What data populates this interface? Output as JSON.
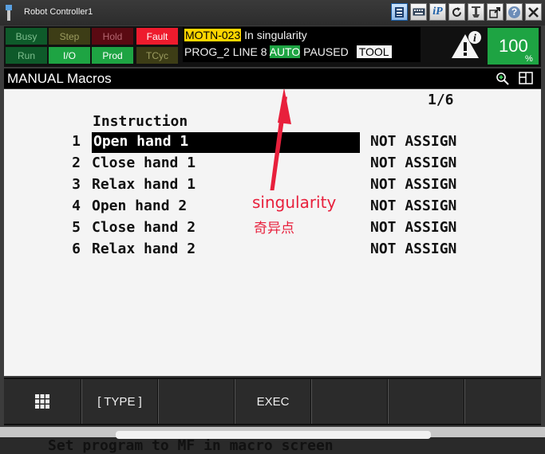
{
  "window": {
    "title": "Robot Controller1"
  },
  "toolbar": {
    "icons": [
      {
        "name": "status-icon",
        "selected": true
      },
      {
        "name": "keyboard-icon",
        "selected": false
      },
      {
        "name": "ip-icon",
        "label": "iP",
        "selected": false
      },
      {
        "name": "refresh-icon",
        "selected": false
      },
      {
        "name": "jog-icon",
        "selected": false
      },
      {
        "name": "external-icon",
        "selected": false
      },
      {
        "name": "help-icon",
        "label": "?",
        "selected": false
      },
      {
        "name": "close-icon",
        "selected": false
      }
    ]
  },
  "status_leds": [
    {
      "label": "Busy",
      "color": "#0e5a2a",
      "text_color": "#7fbf8f"
    },
    {
      "label": "Step",
      "color": "#3d3d16",
      "text_color": "#9c9c60"
    },
    {
      "label": "Hold",
      "color": "#5a0a12",
      "text_color": "#b46670"
    },
    {
      "label": "Fault",
      "color": "#ee1b2d",
      "text_color": "#ffffff"
    },
    {
      "label": "Run",
      "color": "#0e5a2a",
      "text_color": "#7fbf8f"
    },
    {
      "label": "I/O",
      "color": "#1ea443",
      "text_color": "#ffffff"
    },
    {
      "label": "Prod",
      "color": "#1ea443",
      "text_color": "#ffffff"
    },
    {
      "label": "TCyc",
      "color": "#3d3d16",
      "text_color": "#9c9c60"
    }
  ],
  "alarm": {
    "code": "MOTN-023",
    "code_bg": "#ffd600",
    "text": " In singularity",
    "line2_prog": "PROG_2 LINE 8 ",
    "line2_auto": "AUTO",
    "line2_auto_bg": "#1ea443",
    "line2_paused": " PAUSED",
    "line2_frame": "TOOL"
  },
  "override": {
    "value": "100",
    "unit": "%"
  },
  "screen": {
    "title": "MANUAL Macros",
    "page": "1/6",
    "header": "Instruction"
  },
  "rows": [
    {
      "num": "1",
      "text": "Open hand 1",
      "assign": "NOT ASSIGN"
    },
    {
      "num": "2",
      "text": "Close hand 1",
      "assign": "NOT ASSIGN"
    },
    {
      "num": "3",
      "text": "Relax hand 1",
      "assign": "NOT ASSIGN"
    },
    {
      "num": "4",
      "text": "Open hand 2",
      "assign": "NOT ASSIGN"
    },
    {
      "num": "5",
      "text": "Close hand 2",
      "assign": "NOT ASSIGN"
    },
    {
      "num": "6",
      "text": "Relax hand 2",
      "assign": "NOT ASSIGN"
    }
  ],
  "annotation": {
    "en": "singularity",
    "zh": "奇异点",
    "color": "#e8203c"
  },
  "help_line": "Set program to MF in macro screen",
  "function_keys": [
    "",
    "[ TYPE ]",
    "",
    "EXEC",
    "",
    "",
    ""
  ],
  "accent": {
    "green": "#1ea443",
    "red": "#ee1b2d",
    "yellow": "#ffd600"
  }
}
